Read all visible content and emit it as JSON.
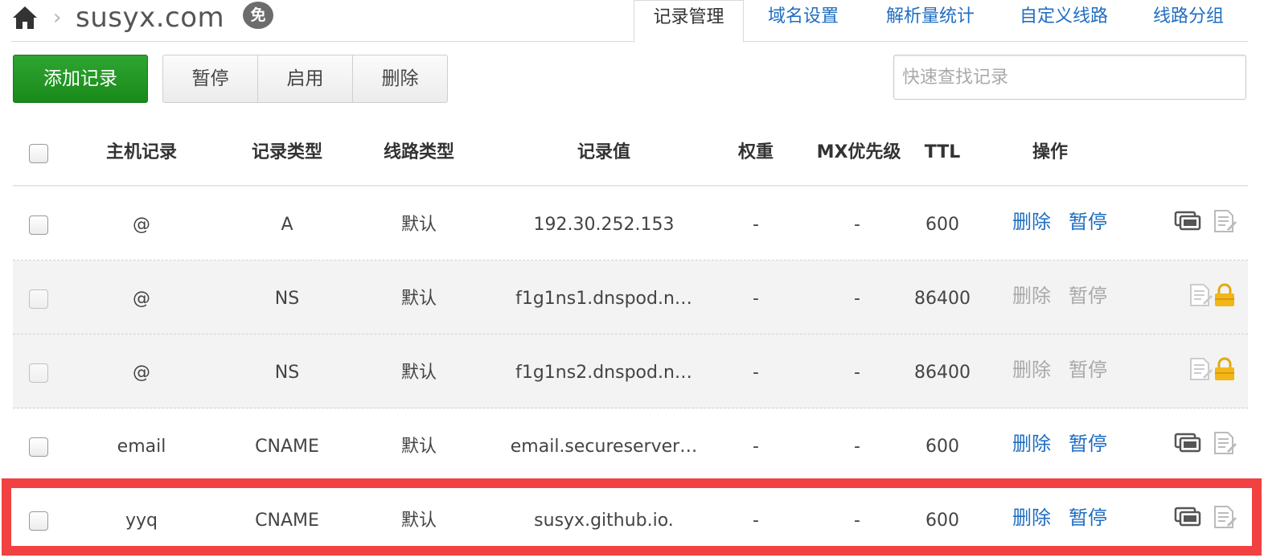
{
  "header": {
    "breadcrumb_sep": "›",
    "domain": "susyx.com",
    "badge": "免",
    "tabs": [
      {
        "label": "记录管理",
        "active": true
      },
      {
        "label": "域名设置",
        "active": false
      },
      {
        "label": "解析量统计",
        "active": false
      },
      {
        "label": "自定义线路",
        "active": false
      },
      {
        "label": "线路分组",
        "active": false
      }
    ]
  },
  "toolbar": {
    "add_label": "添加记录",
    "pause_label": "暂停",
    "enable_label": "启用",
    "delete_label": "删除",
    "search_placeholder": "快速查找记录"
  },
  "table": {
    "columns": [
      "主机记录",
      "记录类型",
      "线路类型",
      "记录值",
      "权重",
      "MX优先级",
      "TTL",
      "操作"
    ],
    "rows": [
      {
        "host": "@",
        "type": "A",
        "line": "默认",
        "value": "192.30.252.153",
        "weight": "-",
        "mx": "-",
        "ttl": "600",
        "delete": "删除",
        "pause": "暂停",
        "locked": false
      },
      {
        "host": "@",
        "type": "NS",
        "line": "默认",
        "value": "f1g1ns1.dnspod.n…",
        "weight": "-",
        "mx": "-",
        "ttl": "86400",
        "delete": "删除",
        "pause": "暂停",
        "locked": true
      },
      {
        "host": "@",
        "type": "NS",
        "line": "默认",
        "value": "f1g1ns2.dnspod.n…",
        "weight": "-",
        "mx": "-",
        "ttl": "86400",
        "delete": "删除",
        "pause": "暂停",
        "locked": true
      },
      {
        "host": "email",
        "type": "CNAME",
        "line": "默认",
        "value": "email.secureserver…",
        "weight": "-",
        "mx": "-",
        "ttl": "600",
        "delete": "删除",
        "pause": "暂停",
        "locked": false
      },
      {
        "host": "yyq",
        "type": "CNAME",
        "line": "默认",
        "value": "susyx.github.io.",
        "weight": "-",
        "mx": "-",
        "ttl": "600",
        "delete": "删除",
        "pause": "暂停",
        "locked": false
      }
    ]
  },
  "colors": {
    "link": "#1f6ec2",
    "add_button": "#1f951f",
    "lock": "#f2b619",
    "highlight": "#f24141"
  },
  "icons": {
    "home": "home-icon",
    "monitor": "monitor-icon",
    "note": "note-icon",
    "lock": "lock-icon"
  }
}
